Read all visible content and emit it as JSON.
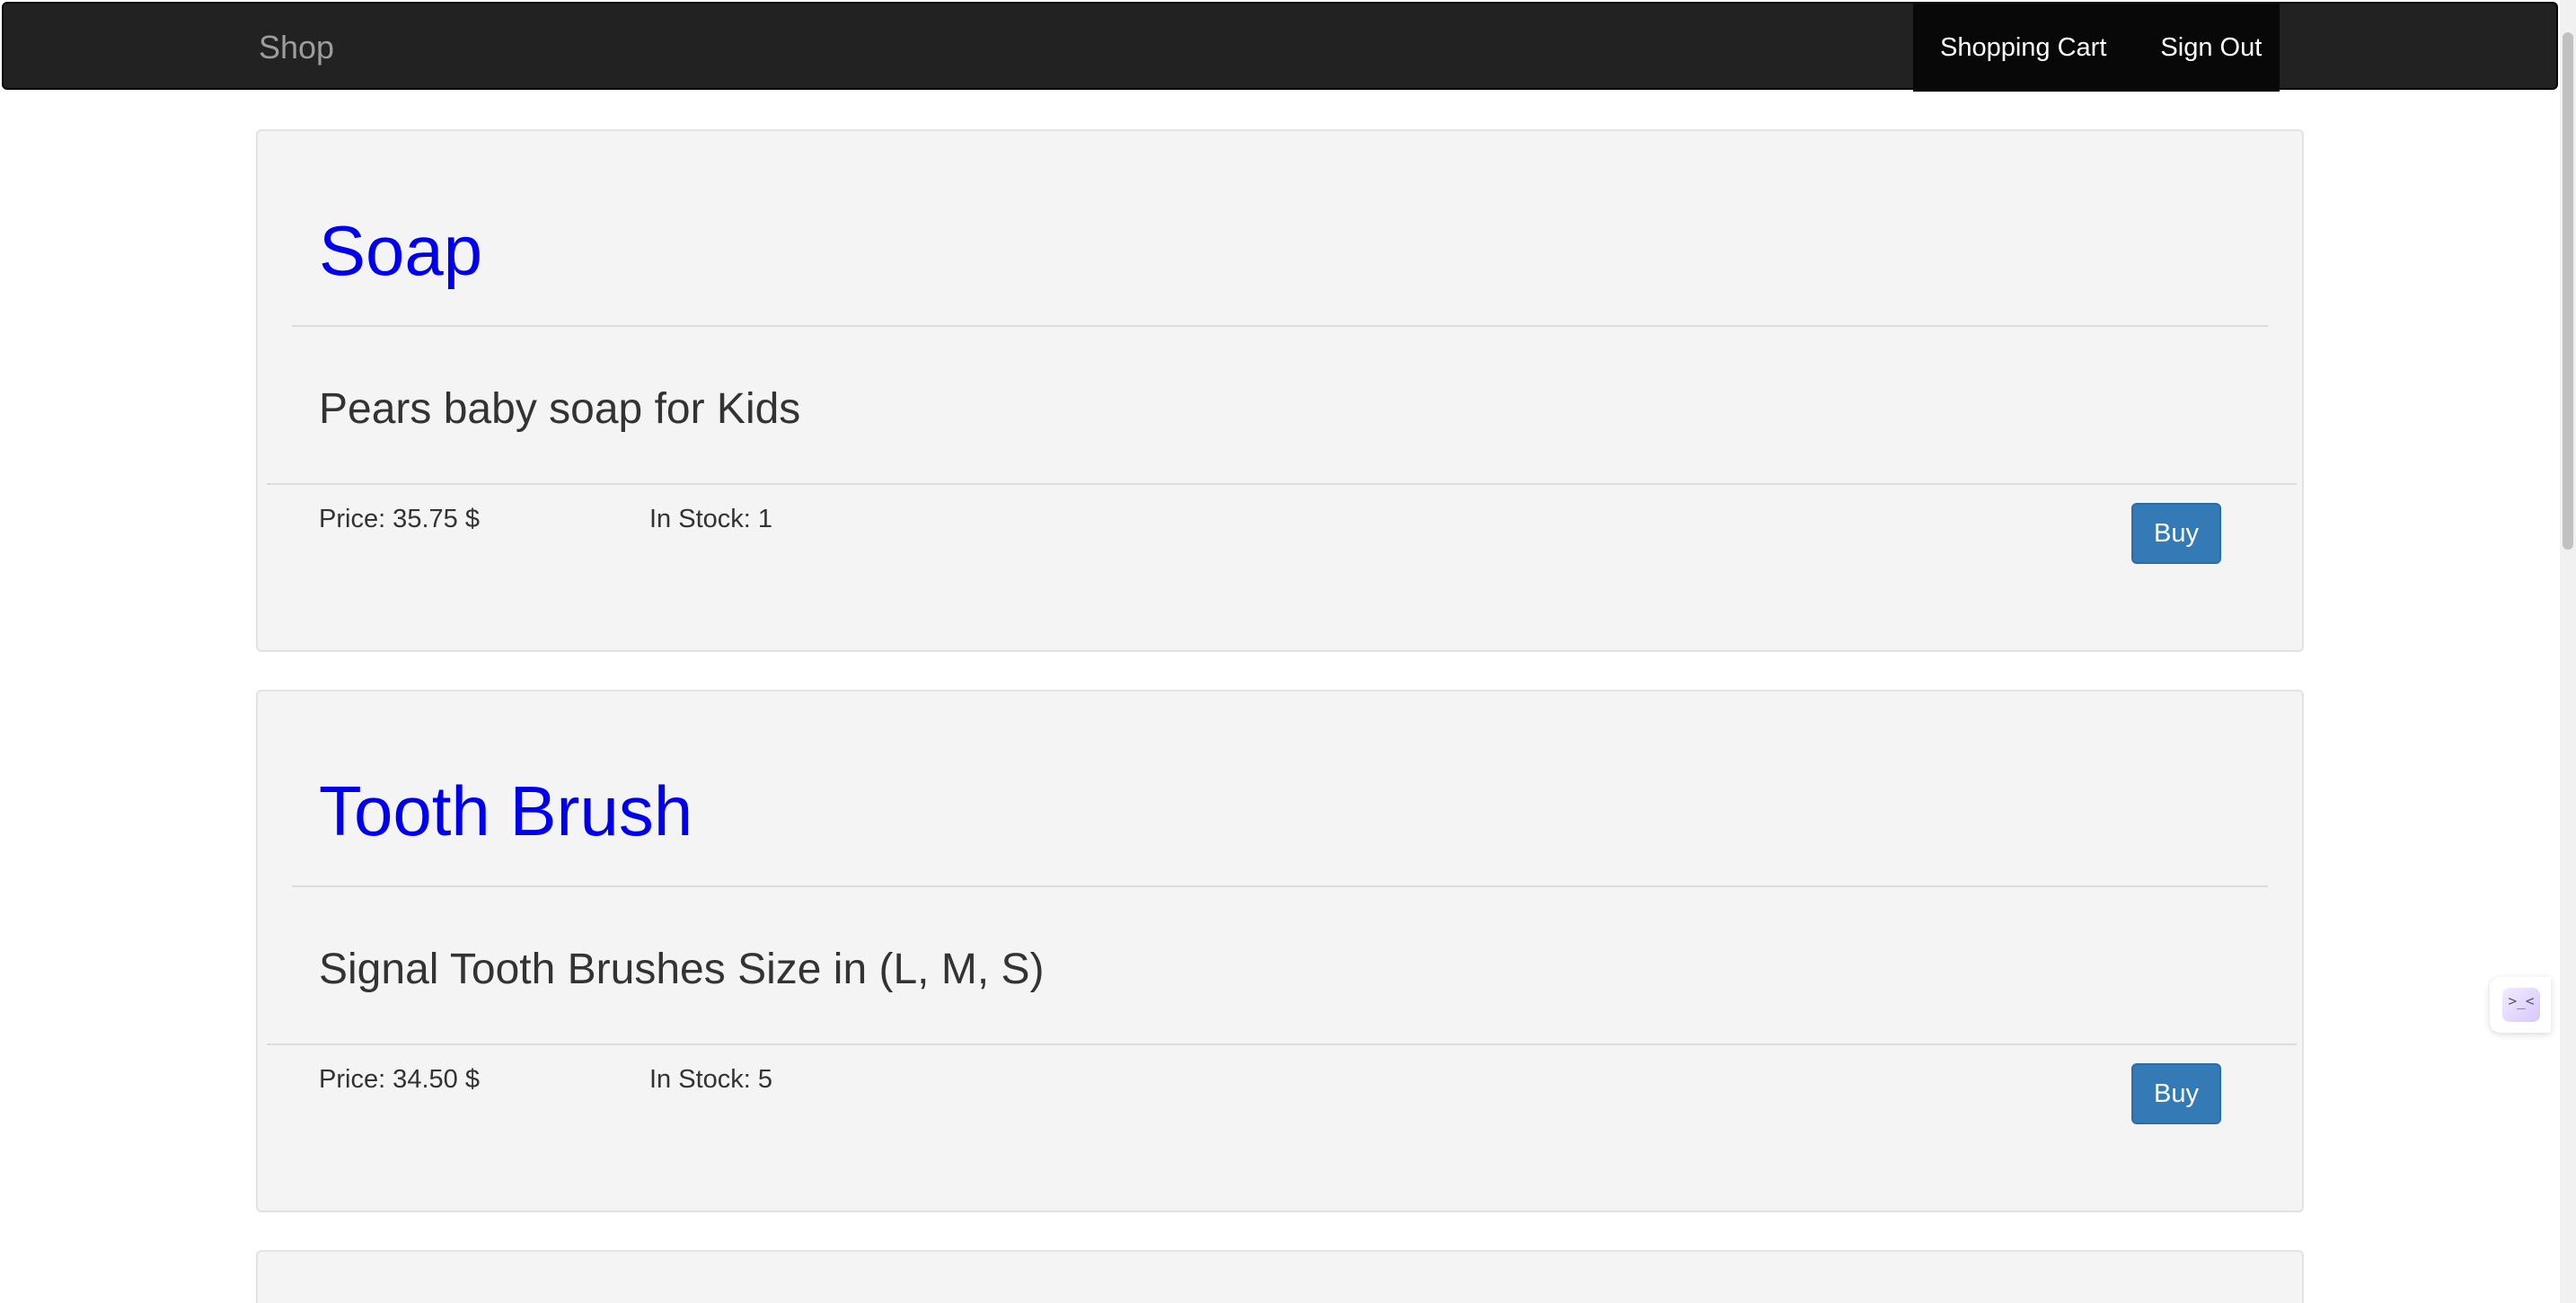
{
  "navbar": {
    "brand": "Shop",
    "links": [
      "Shopping Cart",
      "Sign Out"
    ]
  },
  "products": [
    {
      "title": "Soap",
      "description": "Pears baby soap for Kids",
      "price": "Price: 35.75 $",
      "stock": "In Stock: 1",
      "buy_label": "Buy"
    },
    {
      "title": "Tooth Brush",
      "description": "Signal Tooth Brushes Size in (L, M, S)",
      "price": "Price: 34.50 $",
      "stock": "In Stock: 5",
      "buy_label": "Buy"
    }
  ],
  "widget": {
    "icon": "assistant-face-icon",
    "glyph": ">_<"
  },
  "colors": {
    "navbar_bg": "#222222",
    "title_link": "#0000ee",
    "buy_button": "#337ab7"
  }
}
